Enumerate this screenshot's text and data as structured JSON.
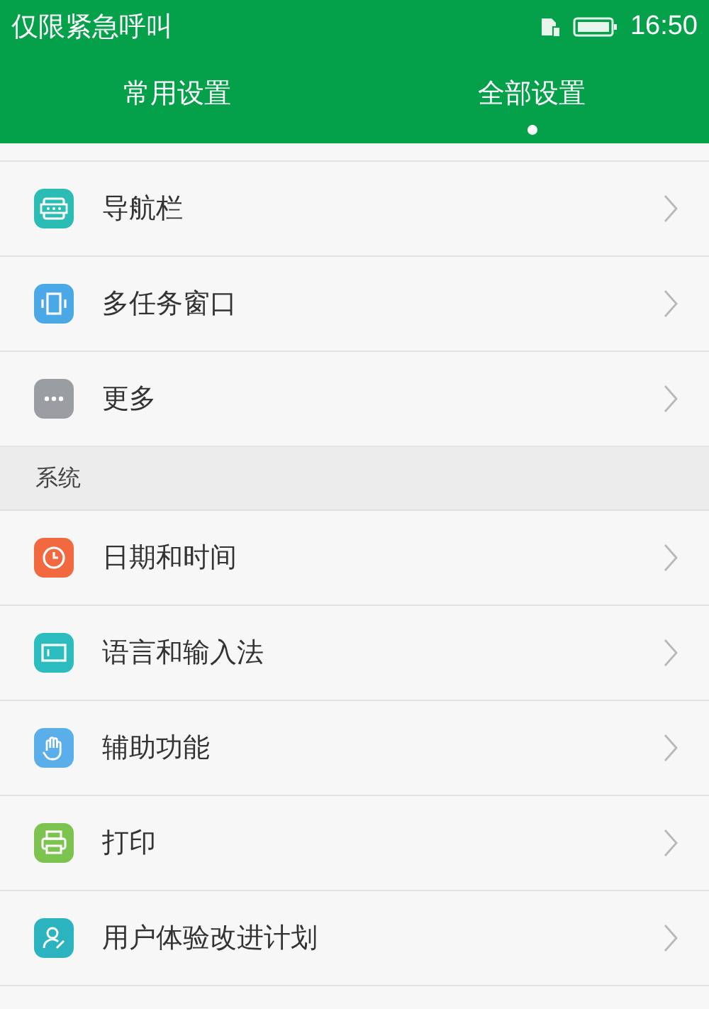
{
  "status_bar": {
    "notice": "仅限紧急呼叫",
    "time": "16:50"
  },
  "tabs": [
    {
      "label": "常用设置",
      "selected": false
    },
    {
      "label": "全部设置",
      "selected": true
    }
  ],
  "groups": [
    {
      "items": [
        {
          "label": "导航栏",
          "kind": "navbar"
        },
        {
          "label": "多任务窗口",
          "kind": "multitask"
        },
        {
          "label": "更多",
          "kind": "more"
        }
      ]
    },
    {
      "title": "系统",
      "items": [
        {
          "label": "日期和时间",
          "kind": "clock"
        },
        {
          "label": "语言和输入法",
          "kind": "keyboard"
        },
        {
          "label": "辅助功能",
          "kind": "hand"
        },
        {
          "label": "打印",
          "kind": "printer"
        },
        {
          "label": "用户体验改进计划",
          "kind": "user"
        }
      ]
    }
  ]
}
